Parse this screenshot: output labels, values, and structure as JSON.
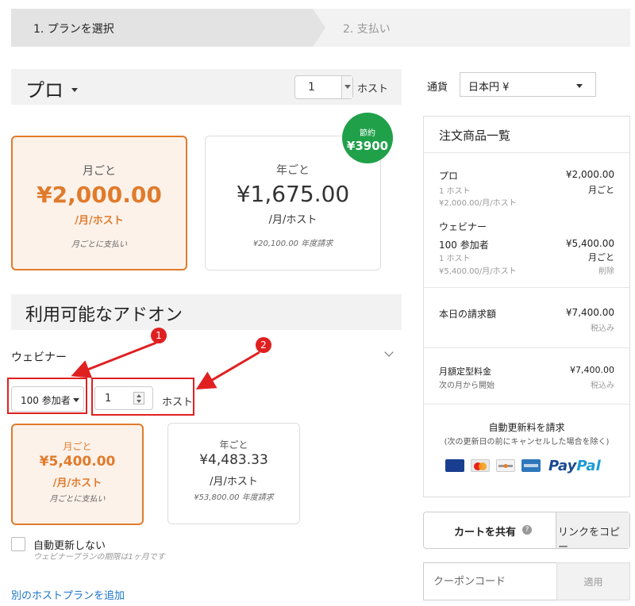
{
  "steps": {
    "step1": "1. プランを選択",
    "step2": "2. 支払い"
  },
  "plan": {
    "name": "プロ",
    "host_qty": "1",
    "host_label": "ホスト",
    "badge_top": "節約",
    "badge_amount": "¥3900",
    "monthly": {
      "title": "月ごと",
      "price": "¥2,000.00",
      "unit": "/月/ホスト",
      "note": "月ごとに支払い"
    },
    "yearly": {
      "title": "年ごと",
      "price": "¥1,675.00",
      "unit": "/月/ホスト",
      "note": "¥20,100.00 年度請求"
    }
  },
  "addons": {
    "title": "利用可能なアドオン",
    "webinar": {
      "label": "ウェビナー",
      "participants": "100 参加者",
      "host_qty": "1",
      "host_label": "ホスト",
      "marker1": "1",
      "marker2": "2",
      "monthly": {
        "title": "月ごと",
        "price": "¥5,400.00",
        "unit": "/月/ホスト",
        "note": "月ごとに支払い"
      },
      "yearly": {
        "title": "年ごと",
        "price": "¥4,483.33",
        "unit": "/月/ホスト",
        "note": "¥53,800.00 年度請求"
      },
      "no_renew_label": "自動更新しない",
      "no_renew_note": "ウェビナープランの期限は1ヶ月です"
    },
    "add_host_link": "別のホストプランを追加"
  },
  "currency": {
    "label": "通貨",
    "value": "日本円 ¥"
  },
  "order": {
    "title": "注文商品一覧",
    "pro": {
      "name": "プロ",
      "price": "¥2,000.00",
      "hosts": "1 ホスト",
      "period": "月ごと",
      "unit": "¥2,000.00/月/ホスト"
    },
    "webinar": {
      "header": "ウェビナー",
      "name": "100 参加者",
      "price": "¥5,400.00",
      "hosts": "1 ホスト",
      "period": "月ごと",
      "unit": "¥5,400.00/月/ホスト",
      "remove": "削除"
    },
    "today": {
      "label": "本日の請求額",
      "amount": "¥7,400.00",
      "tax": "税込み"
    },
    "monthly": {
      "label": "月額定型料金",
      "amount": "¥7,400.00",
      "next": "次の月から開始",
      "tax": "税込み"
    },
    "renew_title": "自動更新料を請求",
    "renew_note": "(次の更新日の前にキャンセルした場合を除く)",
    "cards": [
      "visa-card",
      "mastercard-card",
      "discover-card",
      "amex-card"
    ],
    "paypal_a": "Pay",
    "paypal_b": "Pal"
  },
  "share": {
    "label": "カートを共有",
    "help": "?",
    "copy": "リンクをコピー"
  },
  "coupon": {
    "placeholder": "クーポンコード",
    "apply": "適用"
  }
}
